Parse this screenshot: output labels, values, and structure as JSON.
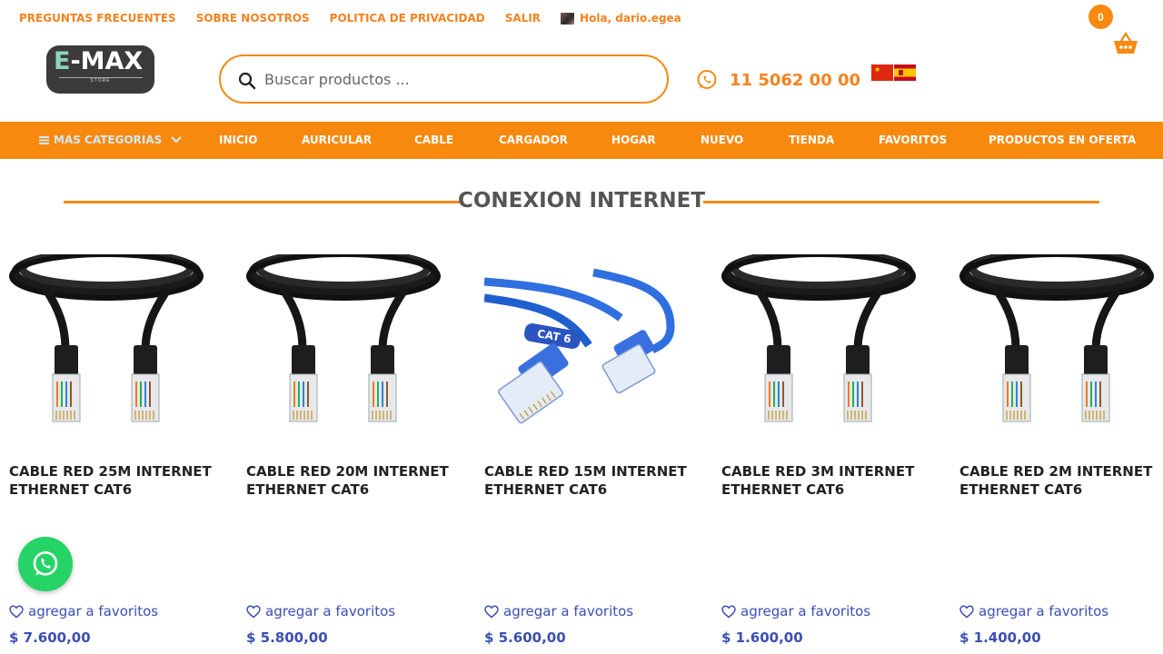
{
  "top_links": [
    "PREGUNTAS FRECUENTES",
    "SOBRE NOSOTROS",
    "POLITICA DE PRIVACIDAD",
    "SALIR"
  ],
  "greeting": "Hola, dario.egea",
  "cart": {
    "count": "0",
    "icon": "basket-icon"
  },
  "logo": {
    "brand": "-MAX",
    "brand_e": "E",
    "sub": "STORE"
  },
  "search": {
    "placeholder": "Buscar productos ...",
    "value": ""
  },
  "phone": {
    "number": "11 5062 00 00",
    "icon": "whatsapp-icon"
  },
  "languages": [
    "zh",
    "es"
  ],
  "nav": {
    "categories_label": "MAS CATEGORIAS",
    "items": [
      "INICIO",
      "AURICULAR",
      "CABLE",
      "CARGADOR",
      "HOGAR",
      "NUEVO",
      "TIENDA",
      "FAVORITOS",
      "PRODUCTOS EN OFERTA"
    ]
  },
  "section_title": "CONEXION INTERNET",
  "favorite_label": "agregar a favoritos",
  "products": [
    {
      "title": "CABLE RED 25M INTERNET ETHERNET CAT6",
      "price": "$ 7.600,00",
      "image": "black-cable"
    },
    {
      "title": "CABLE RED 20M INTERNET ETHERNET CAT6",
      "price": "$ 5.800,00",
      "image": "black-cable"
    },
    {
      "title": "CABLE RED 15M INTERNET ETHERNET CAT6",
      "price": "$ 5.600,00",
      "image": "blue-cable",
      "image_label": "CAT 6"
    },
    {
      "title": "CABLE RED 3M INTERNET ETHERNET CAT6",
      "price": "$ 1.600,00",
      "image": "black-cable"
    },
    {
      "title": "CABLE RED 2M INTERNET ETHERNET CAT6",
      "price": "$ 1.400,00",
      "image": "black-cable"
    }
  ],
  "colors": {
    "accent": "#f7890f",
    "link": "#3a4fb3",
    "whatsapp": "#25d366"
  }
}
